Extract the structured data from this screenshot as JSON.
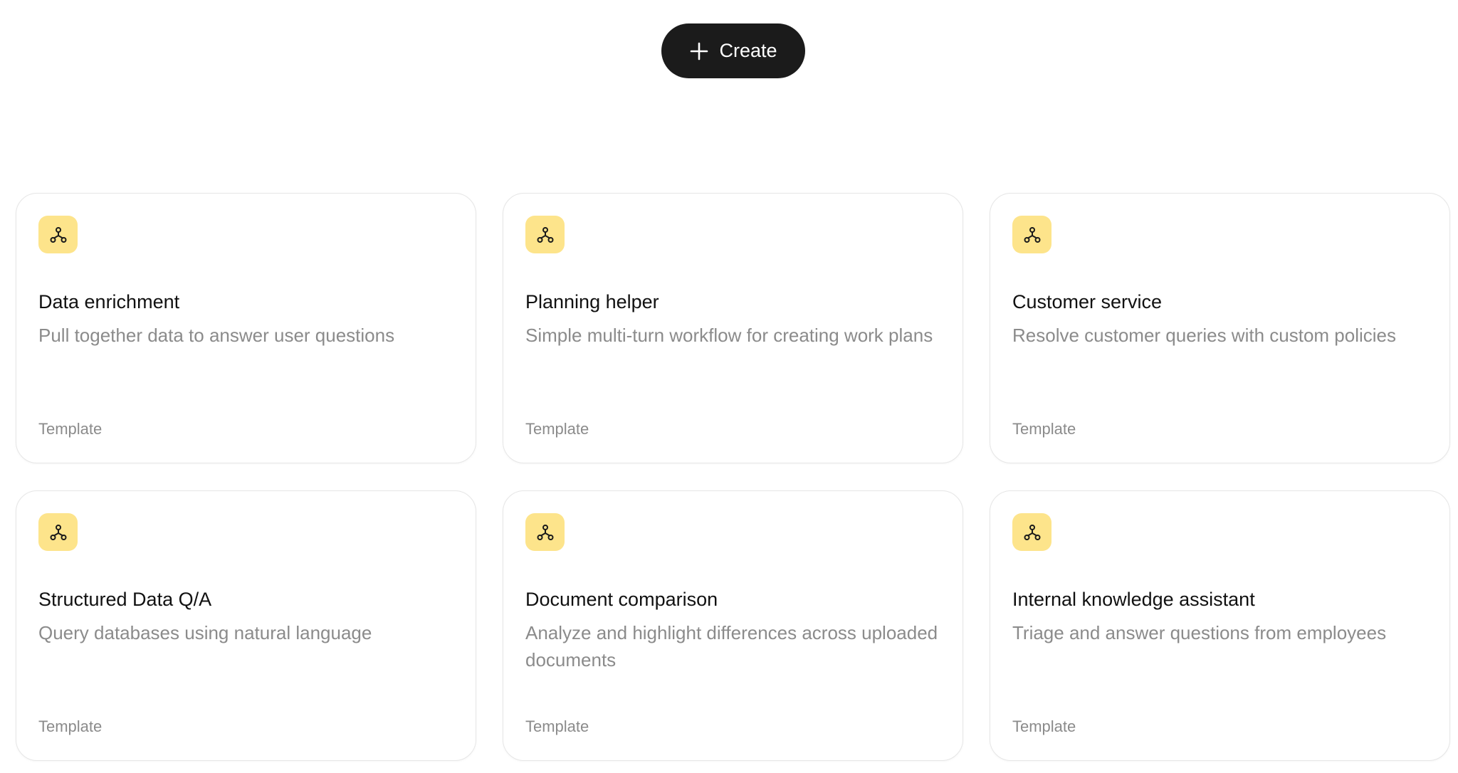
{
  "header": {
    "create_label": "Create",
    "create_icon": "plus-icon"
  },
  "colors": {
    "create_bg": "#1b1b1b",
    "icon_badge_bg": "#fde48b",
    "card_border": "#e6e6e6",
    "muted_text": "#8b8b8b"
  },
  "templates": [
    {
      "title": "Data enrichment",
      "description": "Pull together data to answer user questions",
      "tag": "Template",
      "icon": "workflow-icon"
    },
    {
      "title": "Planning helper",
      "description": "Simple multi-turn workflow for creating work plans",
      "tag": "Template",
      "icon": "workflow-icon"
    },
    {
      "title": "Customer service",
      "description": "Resolve customer queries with custom policies",
      "tag": "Template",
      "icon": "workflow-icon"
    },
    {
      "title": "Structured Data Q/A",
      "description": "Query databases using natural language",
      "tag": "Template",
      "icon": "workflow-icon"
    },
    {
      "title": "Document comparison",
      "description": "Analyze and highlight differences across uploaded documents",
      "tag": "Template",
      "icon": "workflow-icon"
    },
    {
      "title": "Internal knowledge assistant",
      "description": "Triage and answer questions from employees",
      "tag": "Template",
      "icon": "workflow-icon"
    }
  ]
}
